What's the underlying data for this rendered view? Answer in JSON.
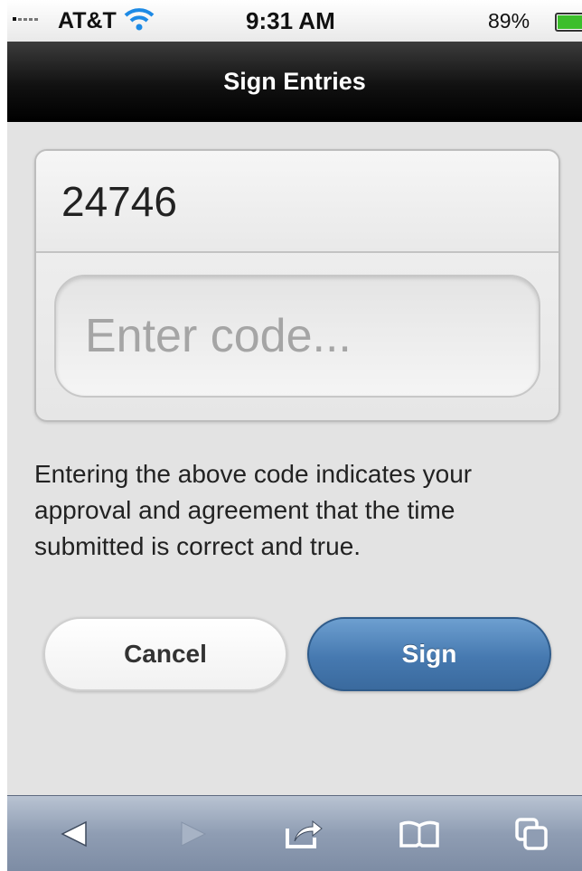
{
  "status_bar": {
    "carrier": "AT&T",
    "time": "9:31 AM",
    "battery_percent": "89%",
    "battery_level": 0.89
  },
  "header": {
    "title": "Sign Entries"
  },
  "form": {
    "entry_id": "24746",
    "code_input": {
      "placeholder": "Enter code...",
      "value": ""
    },
    "notice": "Entering the above code indicates your approval and agreement that the time submitted is correct and true."
  },
  "buttons": {
    "cancel_label": "Cancel",
    "sign_label": "Sign"
  },
  "toolbar": {
    "items": [
      "back-icon",
      "forward-icon",
      "share-icon",
      "bookmarks-icon",
      "tabs-icon"
    ]
  },
  "colors": {
    "header_bg": "#111111",
    "sign_button": "#4679b0",
    "toolbar_bg": "#8f9db3",
    "battery_fill": "#3cbe2b"
  }
}
